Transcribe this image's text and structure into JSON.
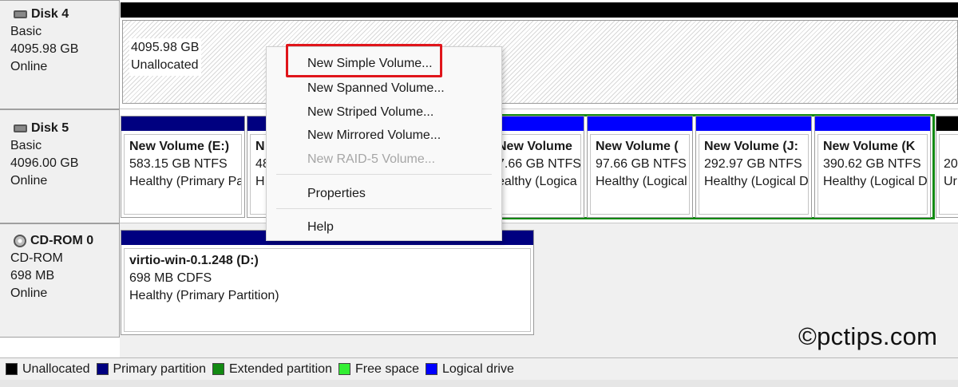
{
  "disks": [
    {
      "name": "Disk 4",
      "type": "Basic",
      "size": "4095.98 GB",
      "status": "Online"
    },
    {
      "name": "Disk 5",
      "type": "Basic",
      "size": "4096.00 GB",
      "status": "Online"
    },
    {
      "name": "CD-ROM 0",
      "type": "CD-ROM",
      "size": "698 MB",
      "status": "Online"
    }
  ],
  "disk4_unallocated": {
    "size": "4095.98 GB",
    "label": "Unallocated"
  },
  "disk5_partitions": [
    {
      "title": "New Volume  (E:)",
      "size": "583.15 GB NTFS",
      "status": "Healthy (Primary Pa"
    },
    {
      "title": "N",
      "size": "48",
      "status": "H"
    },
    {
      "title": "New Volume",
      "size": "7.66 GB NTFS",
      "status": "ealthy (Logica"
    },
    {
      "title": "New Volume  (",
      "size": "97.66 GB NTFS",
      "status": "Healthy (Logical"
    },
    {
      "title": "New Volume  (J:",
      "size": "292.97 GB NTFS",
      "status": "Healthy (Logical D"
    },
    {
      "title": "New Volume  (K",
      "size": "390.62 GB NTFS",
      "status": "Healthy (Logical D"
    },
    {
      "title": "",
      "size": "20",
      "status": "Ur"
    }
  ],
  "cdrom_partition": {
    "title": "virtio-win-0.1.248  (D:)",
    "size": "698 MB CDFS",
    "status": "Healthy (Primary Partition)"
  },
  "context_menu": {
    "items": [
      {
        "label": "New Simple Volume...",
        "enabled": true
      },
      {
        "label": "New Spanned Volume...",
        "enabled": true
      },
      {
        "label": "New Striped Volume...",
        "enabled": true
      },
      {
        "label": "New Mirrored Volume...",
        "enabled": true
      },
      {
        "label": "New RAID-5 Volume...",
        "enabled": false
      },
      {
        "label": "Properties",
        "enabled": true
      },
      {
        "label": "Help",
        "enabled": true
      }
    ]
  },
  "legend": [
    {
      "label": "Unallocated",
      "color": "#000000"
    },
    {
      "label": "Primary partition",
      "color": "#000080"
    },
    {
      "label": "Extended partition",
      "color": "#128a12"
    },
    {
      "label": "Free space",
      "color": "#33ee33"
    },
    {
      "label": "Logical drive",
      "color": "#0000ff"
    }
  ],
  "watermark": "©pctips.com",
  "icons": {
    "disk": "hard-disk-icon",
    "cdrom": "cdrom-icon"
  }
}
